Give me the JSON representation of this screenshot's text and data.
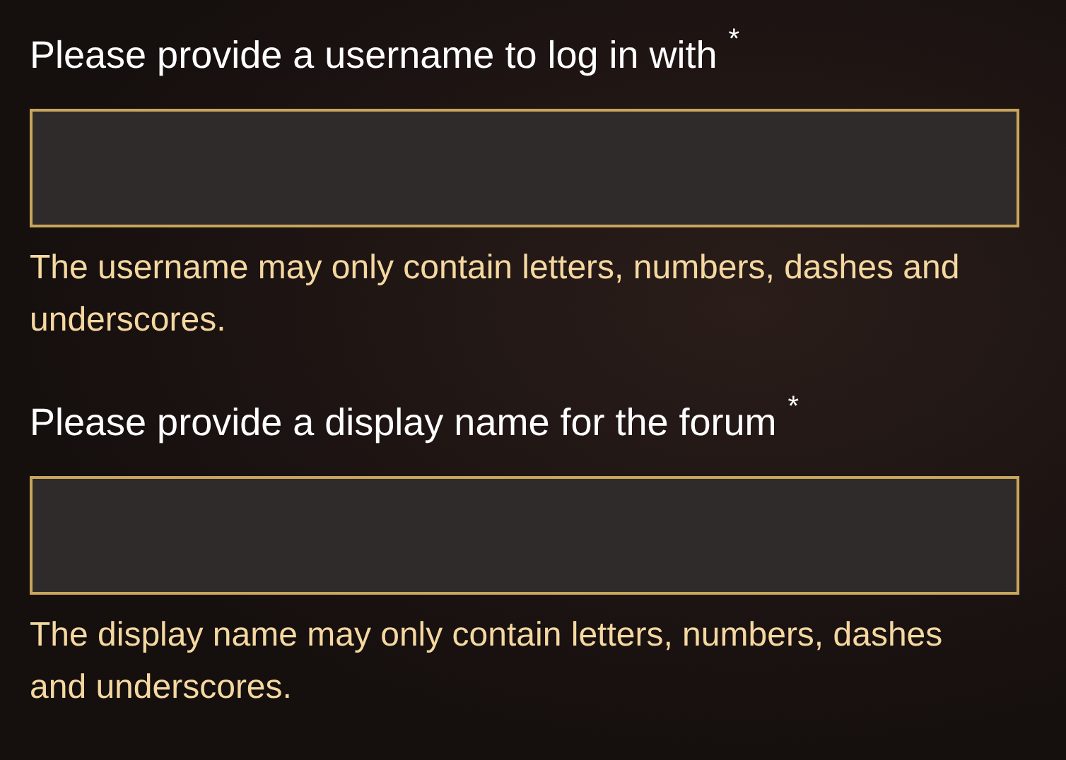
{
  "fields": [
    {
      "label": "Please provide a username to log in with",
      "required_mark": "*",
      "hint": "The username may only contain letters, numbers, dashes and underscores."
    },
    {
      "label": "Please provide a display name for the forum",
      "required_mark": "*",
      "hint": "The display name may only contain letters, numbers, dashes and underscores."
    }
  ]
}
